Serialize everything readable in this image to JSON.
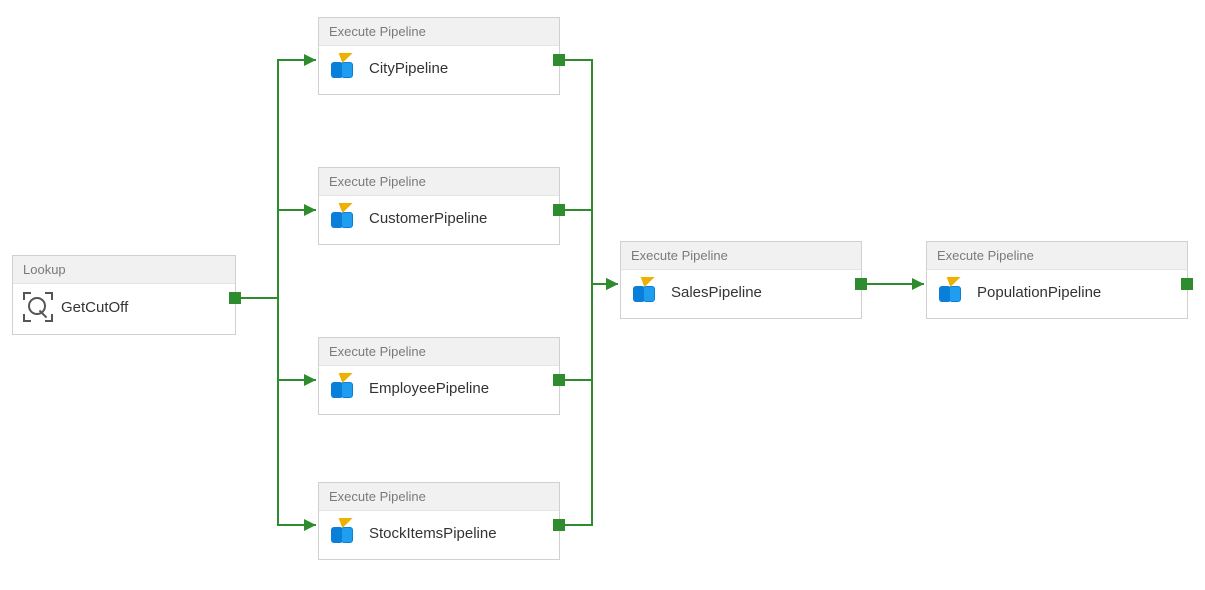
{
  "activities": {
    "lookup": {
      "type_label": "Lookup",
      "name": "GetCutOff"
    },
    "city": {
      "type_label": "Execute Pipeline",
      "name": "CityPipeline"
    },
    "customer": {
      "type_label": "Execute Pipeline",
      "name": "CustomerPipeline"
    },
    "employee": {
      "type_label": "Execute Pipeline",
      "name": "EmployeePipeline"
    },
    "stock": {
      "type_label": "Execute Pipeline",
      "name": "StockItemsPipeline"
    },
    "sales": {
      "type_label": "Execute Pipeline",
      "name": "SalesPipeline"
    },
    "population": {
      "type_label": "Execute Pipeline",
      "name": "PopulationPipeline"
    }
  },
  "colors": {
    "connector": "#2e8b2e",
    "node_border": "#d0d0d0",
    "header_bg": "#f1f1f1"
  },
  "edges": [
    {
      "from": "lookup",
      "to": "city"
    },
    {
      "from": "lookup",
      "to": "customer"
    },
    {
      "from": "lookup",
      "to": "employee"
    },
    {
      "from": "lookup",
      "to": "stock"
    },
    {
      "from": "city",
      "to": "sales"
    },
    {
      "from": "customer",
      "to": "sales"
    },
    {
      "from": "employee",
      "to": "sales"
    },
    {
      "from": "stock",
      "to": "sales"
    },
    {
      "from": "sales",
      "to": "population"
    }
  ],
  "layout_note": "Lookup fans out in parallel to four Execute Pipeline activities, which all converge on SalesPipeline, then PopulationPipeline."
}
